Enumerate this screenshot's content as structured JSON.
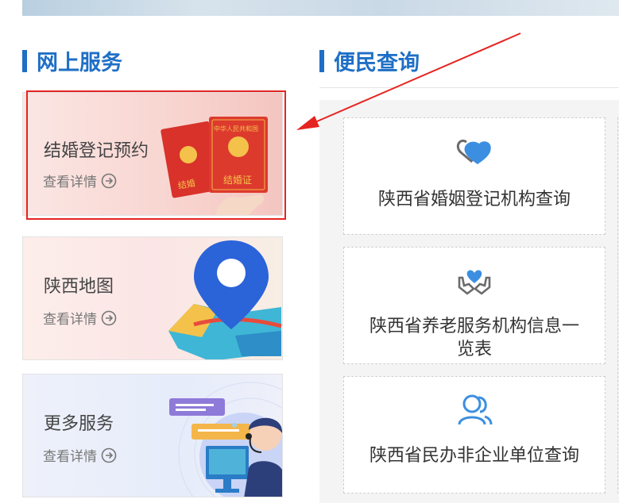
{
  "sections": {
    "online_services": {
      "title": "网上服务"
    },
    "public_query": {
      "title": "便民查询"
    }
  },
  "cards": [
    {
      "title": "结婚登记预约",
      "detail": "查看详情",
      "icon": "marriage-certificate-icon"
    },
    {
      "title": "陕西地图",
      "detail": "查看详情",
      "icon": "map-pin-icon"
    },
    {
      "title": "更多服务",
      "detail": "查看详情",
      "icon": "customer-service-icon"
    }
  ],
  "certificate": {
    "header": "中华人民共和国",
    "left_text": "结婚",
    "right_text": "结婚证"
  },
  "queries": [
    {
      "label": "陕西省婚姻登记机构查询",
      "icon": "hearts-icon"
    },
    {
      "label": "陕西省养老服务机构信息一览表",
      "icon": "care-hands-icon"
    },
    {
      "label": "陕西省民办非企业单位查询",
      "icon": "people-icon"
    }
  ],
  "colors": {
    "accent": "#1f6fc6",
    "highlight": "#e52421"
  }
}
